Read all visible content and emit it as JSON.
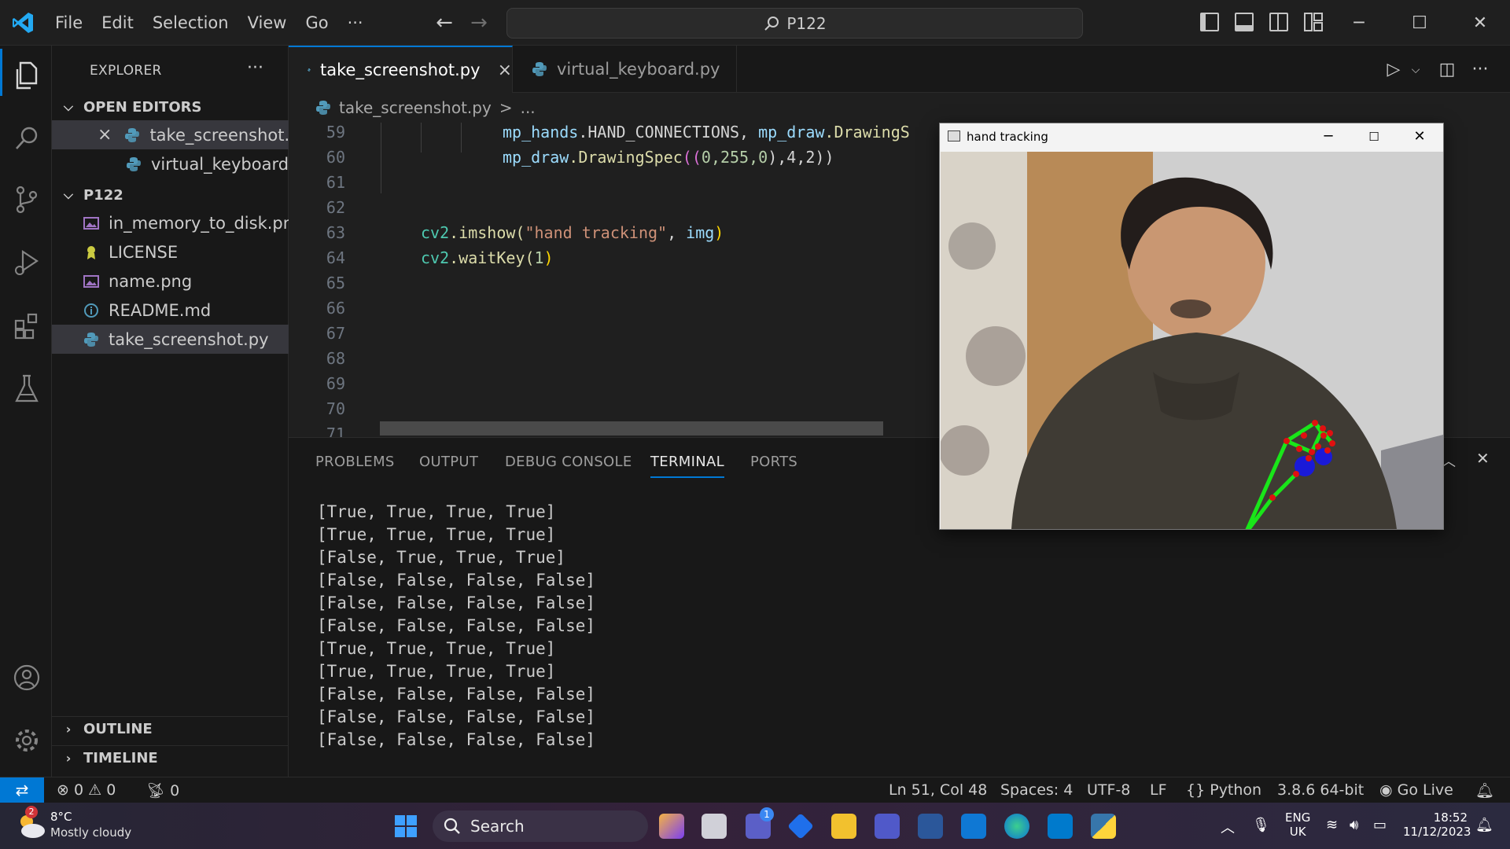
{
  "menu": [
    "File",
    "Edit",
    "Selection",
    "View",
    "Go",
    "···"
  ],
  "command_center": "P122",
  "sidebar": {
    "title": "EXPLORER",
    "open_editors_label": "OPEN EDITORS",
    "open_editors": [
      {
        "name": "take_screenshot....",
        "close": "×"
      },
      {
        "name": "virtual_keyboard..."
      }
    ],
    "folder_label": "P122",
    "files": [
      {
        "name": "in_memory_to_disk.png",
        "icon": "image-icon"
      },
      {
        "name": "LICENSE",
        "icon": "license-icon"
      },
      {
        "name": "name.png",
        "icon": "image-icon"
      },
      {
        "name": "README.md",
        "icon": "info-icon"
      },
      {
        "name": "take_screenshot.py",
        "icon": "python-icon"
      }
    ],
    "outline_label": "OUTLINE",
    "timeline_label": "TIMELINE"
  },
  "tabs": [
    {
      "label": "take_screenshot.py",
      "active": true,
      "close": "×"
    },
    {
      "label": "virtual_keyboard.py",
      "active": false
    }
  ],
  "breadcrumb": {
    "file": "take_screenshot.py",
    "sep": ">",
    "rest": "..."
  },
  "code": {
    "line_numbers": [
      "59",
      "60",
      "61",
      "62",
      "63",
      "64",
      "65",
      "66",
      "67",
      "68",
      "69",
      "70",
      "71"
    ],
    "l59_a": "mp_hands",
    "l59_b": ".HAND_CONNECTIONS, ",
    "l59_c": "mp_draw",
    "l59_d": ".DrawingS",
    "l60_a": "mp_draw",
    "l60_b": ".DrawingSpec",
    "l60_c": "((",
    "l60_d": "0",
    "l60_e": ",255,",
    "l60_f": "0",
    "l60_g": "),4,2))",
    "l63_a": "cv2",
    "l63_b": ".imshow(",
    "l63_c": "\"hand tracking\"",
    "l63_d": ", ",
    "l63_e": "img",
    "l63_f": ")",
    "l64_a": "cv2",
    "l64_b": ".waitKey(",
    "l64_c": "1",
    "l64_d": ")"
  },
  "panel": {
    "tabs": [
      "PROBLEMS",
      "OUTPUT",
      "DEBUG CONSOLE",
      "TERMINAL",
      "PORTS"
    ],
    "active_tab": "TERMINAL",
    "terminal_lines": [
      "[True, True, True, True]",
      "[True, True, True, True]",
      "[False, True, True, True]",
      "[False, False, False, False]",
      "[False, False, False, False]",
      "[False, False, False, False]",
      "[True, True, True, True]",
      "[True, True, True, True]",
      "[False, False, False, False]",
      "[False, False, False, False]",
      "[False, False, False, False]"
    ]
  },
  "cv_window": {
    "title": "hand tracking"
  },
  "statusbar": {
    "errors": "0",
    "warnings": "0",
    "ports": "0",
    "position": "Ln 51, Col 48",
    "spaces": "Spaces: 4",
    "encoding": "UTF-8",
    "eol": "LF",
    "language": "Python",
    "interpreter": "3.8.6 64-bit",
    "go_live": "Go Live"
  },
  "taskbar": {
    "weather_temp": "8°C",
    "weather_desc": "Mostly cloudy",
    "weather_badge": "2",
    "search_placeholder": "Search",
    "chat_badge": "1",
    "lang_top": "ENG",
    "lang_bottom": "UK",
    "time": "18:52",
    "date": "11/12/2023"
  },
  "colors": {
    "accent": "#0078d4",
    "keyword_var": "#9cdcfe",
    "func": "#dcdcaa",
    "string": "#ce9178",
    "number": "#b5cea8",
    "class": "#4ec9b0",
    "bracket_gold": "#ffd700",
    "bracket_pink": "#da70d6",
    "bracket_blue": "#179fff"
  }
}
